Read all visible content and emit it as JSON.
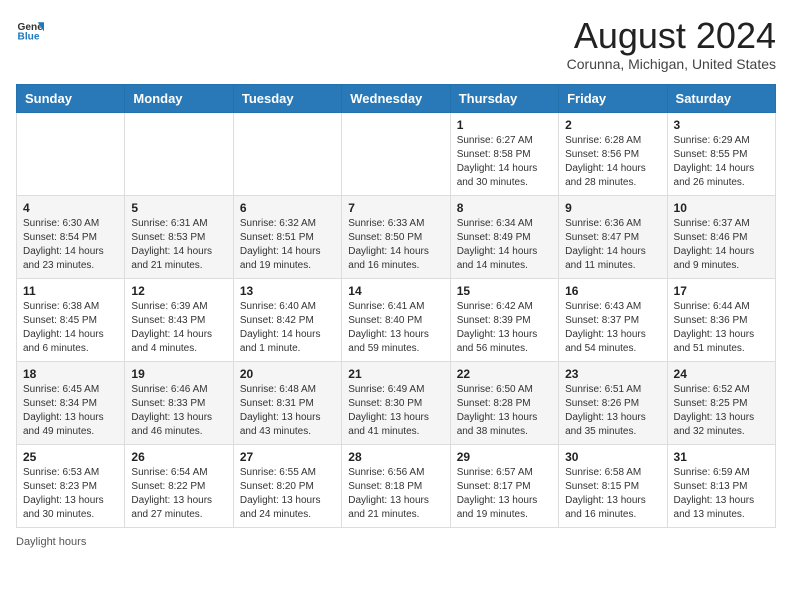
{
  "header": {
    "logo_line1": "General",
    "logo_line2": "Blue",
    "month_year": "August 2024",
    "location": "Corunna, Michigan, United States"
  },
  "days_of_week": [
    "Sunday",
    "Monday",
    "Tuesday",
    "Wednesday",
    "Thursday",
    "Friday",
    "Saturday"
  ],
  "weeks": [
    [
      {
        "day": "",
        "info": ""
      },
      {
        "day": "",
        "info": ""
      },
      {
        "day": "",
        "info": ""
      },
      {
        "day": "",
        "info": ""
      },
      {
        "day": "1",
        "info": "Sunrise: 6:27 AM\nSunset: 8:58 PM\nDaylight: 14 hours and 30 minutes."
      },
      {
        "day": "2",
        "info": "Sunrise: 6:28 AM\nSunset: 8:56 PM\nDaylight: 14 hours and 28 minutes."
      },
      {
        "day": "3",
        "info": "Sunrise: 6:29 AM\nSunset: 8:55 PM\nDaylight: 14 hours and 26 minutes."
      }
    ],
    [
      {
        "day": "4",
        "info": "Sunrise: 6:30 AM\nSunset: 8:54 PM\nDaylight: 14 hours and 23 minutes."
      },
      {
        "day": "5",
        "info": "Sunrise: 6:31 AM\nSunset: 8:53 PM\nDaylight: 14 hours and 21 minutes."
      },
      {
        "day": "6",
        "info": "Sunrise: 6:32 AM\nSunset: 8:51 PM\nDaylight: 14 hours and 19 minutes."
      },
      {
        "day": "7",
        "info": "Sunrise: 6:33 AM\nSunset: 8:50 PM\nDaylight: 14 hours and 16 minutes."
      },
      {
        "day": "8",
        "info": "Sunrise: 6:34 AM\nSunset: 8:49 PM\nDaylight: 14 hours and 14 minutes."
      },
      {
        "day": "9",
        "info": "Sunrise: 6:36 AM\nSunset: 8:47 PM\nDaylight: 14 hours and 11 minutes."
      },
      {
        "day": "10",
        "info": "Sunrise: 6:37 AM\nSunset: 8:46 PM\nDaylight: 14 hours and 9 minutes."
      }
    ],
    [
      {
        "day": "11",
        "info": "Sunrise: 6:38 AM\nSunset: 8:45 PM\nDaylight: 14 hours and 6 minutes."
      },
      {
        "day": "12",
        "info": "Sunrise: 6:39 AM\nSunset: 8:43 PM\nDaylight: 14 hours and 4 minutes."
      },
      {
        "day": "13",
        "info": "Sunrise: 6:40 AM\nSunset: 8:42 PM\nDaylight: 14 hours and 1 minute."
      },
      {
        "day": "14",
        "info": "Sunrise: 6:41 AM\nSunset: 8:40 PM\nDaylight: 13 hours and 59 minutes."
      },
      {
        "day": "15",
        "info": "Sunrise: 6:42 AM\nSunset: 8:39 PM\nDaylight: 13 hours and 56 minutes."
      },
      {
        "day": "16",
        "info": "Sunrise: 6:43 AM\nSunset: 8:37 PM\nDaylight: 13 hours and 54 minutes."
      },
      {
        "day": "17",
        "info": "Sunrise: 6:44 AM\nSunset: 8:36 PM\nDaylight: 13 hours and 51 minutes."
      }
    ],
    [
      {
        "day": "18",
        "info": "Sunrise: 6:45 AM\nSunset: 8:34 PM\nDaylight: 13 hours and 49 minutes."
      },
      {
        "day": "19",
        "info": "Sunrise: 6:46 AM\nSunset: 8:33 PM\nDaylight: 13 hours and 46 minutes."
      },
      {
        "day": "20",
        "info": "Sunrise: 6:48 AM\nSunset: 8:31 PM\nDaylight: 13 hours and 43 minutes."
      },
      {
        "day": "21",
        "info": "Sunrise: 6:49 AM\nSunset: 8:30 PM\nDaylight: 13 hours and 41 minutes."
      },
      {
        "day": "22",
        "info": "Sunrise: 6:50 AM\nSunset: 8:28 PM\nDaylight: 13 hours and 38 minutes."
      },
      {
        "day": "23",
        "info": "Sunrise: 6:51 AM\nSunset: 8:26 PM\nDaylight: 13 hours and 35 minutes."
      },
      {
        "day": "24",
        "info": "Sunrise: 6:52 AM\nSunset: 8:25 PM\nDaylight: 13 hours and 32 minutes."
      }
    ],
    [
      {
        "day": "25",
        "info": "Sunrise: 6:53 AM\nSunset: 8:23 PM\nDaylight: 13 hours and 30 minutes."
      },
      {
        "day": "26",
        "info": "Sunrise: 6:54 AM\nSunset: 8:22 PM\nDaylight: 13 hours and 27 minutes."
      },
      {
        "day": "27",
        "info": "Sunrise: 6:55 AM\nSunset: 8:20 PM\nDaylight: 13 hours and 24 minutes."
      },
      {
        "day": "28",
        "info": "Sunrise: 6:56 AM\nSunset: 8:18 PM\nDaylight: 13 hours and 21 minutes."
      },
      {
        "day": "29",
        "info": "Sunrise: 6:57 AM\nSunset: 8:17 PM\nDaylight: 13 hours and 19 minutes."
      },
      {
        "day": "30",
        "info": "Sunrise: 6:58 AM\nSunset: 8:15 PM\nDaylight: 13 hours and 16 minutes."
      },
      {
        "day": "31",
        "info": "Sunrise: 6:59 AM\nSunset: 8:13 PM\nDaylight: 13 hours and 13 minutes."
      }
    ]
  ],
  "footer": {
    "daylight_label": "Daylight hours"
  }
}
